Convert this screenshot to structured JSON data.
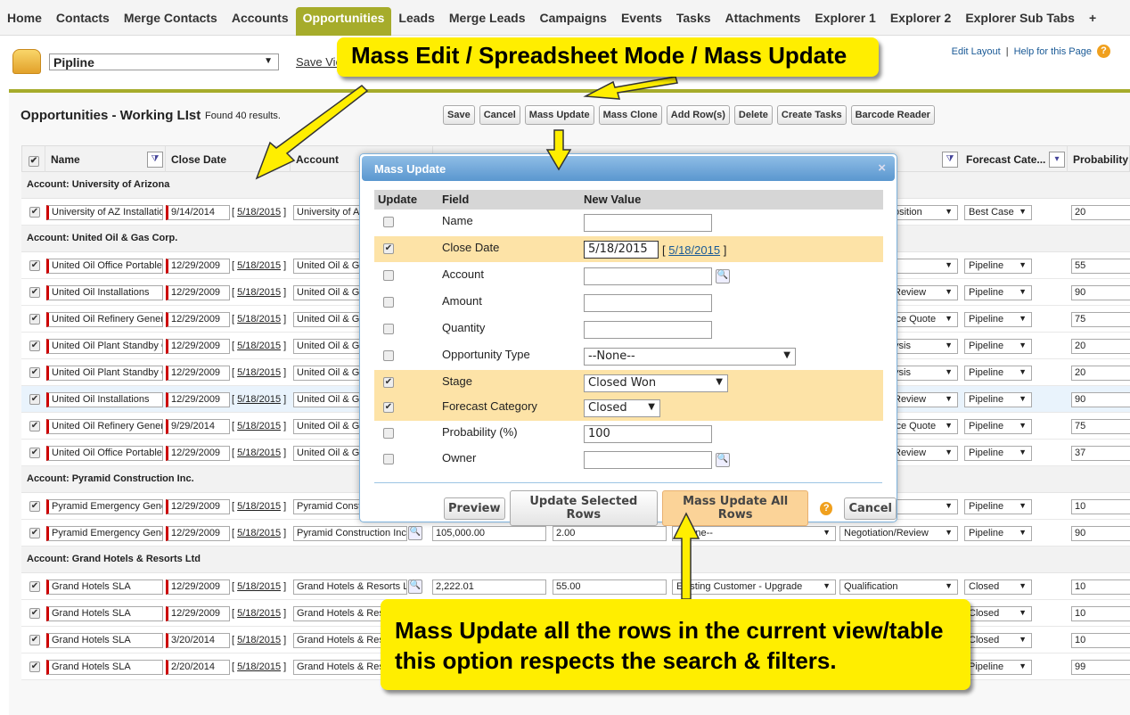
{
  "nav": {
    "tabs": [
      "Home",
      "Contacts",
      "Merge Contacts",
      "Accounts",
      "Opportunities",
      "Leads",
      "Merge Leads",
      "Campaigns",
      "Events",
      "Tasks",
      "Attachments",
      "Explorer 1",
      "Explorer 2",
      "Explorer Sub Tabs",
      "+"
    ],
    "active": "Opportunities"
  },
  "view": {
    "selected": "Pipline",
    "save_view": "Save View"
  },
  "links": {
    "edit_layout": "Edit Layout",
    "sep": "|",
    "help": "Help for this Page",
    "help_icon": "?"
  },
  "list": {
    "title": "Opportunities - Working LIst",
    "found": "Found 40 results."
  },
  "toolbar": [
    "Save",
    "Cancel",
    "Mass Update",
    "Mass Clone",
    "Add Row(s)",
    "Delete",
    "Create Tasks",
    "Barcode Reader"
  ],
  "columns": [
    "Name",
    "Close Date",
    "Account",
    "Forecast Cate...",
    "Probability (%)"
  ],
  "groups": [
    {
      "label": "Account: University of Arizona",
      "rows": [
        {
          "name": "University of AZ Installations",
          "close": "9/14/2014",
          "today": "5/18/2015",
          "account": "University of Arizona",
          "stage": "osition",
          "forecast": "Best Case",
          "prob": "20"
        }
      ]
    },
    {
      "label": "Account: United Oil & Gas Corp.",
      "rows": [
        {
          "name": "United Oil Office Portable",
          "close": "12/29/2009",
          "today": "5/18/2015",
          "account": "United Oil & Gas",
          "stage": "",
          "forecast": "Pipeline",
          "prob": "55"
        },
        {
          "name": "United Oil Installations",
          "close": "12/29/2009",
          "today": "5/18/2015",
          "account": "United Oil & Gas",
          "stage": "Review",
          "forecast": "Pipeline",
          "prob": "90"
        },
        {
          "name": "United Oil Refinery Generators",
          "close": "12/29/2009",
          "today": "5/18/2015",
          "account": "United Oil & Gas",
          "stage": "ice Quote",
          "forecast": "Pipeline",
          "prob": "75"
        },
        {
          "name": "United Oil Plant Standby Gen",
          "close": "12/29/2009",
          "today": "5/18/2015",
          "account": "United Oil & Gas",
          "stage": "ysis",
          "forecast": "Pipeline",
          "prob": "20"
        },
        {
          "name": "United Oil Plant Standby Gen",
          "close": "12/29/2009",
          "today": "5/18/2015",
          "account": "United Oil & Gas",
          "stage": "ysis",
          "forecast": "Pipeline",
          "prob": "20"
        },
        {
          "name": "United Oil Installations",
          "close": "12/29/2009",
          "today": "5/18/2015",
          "account": "United Oil & Gas",
          "stage": "Review",
          "forecast": "Pipeline",
          "prob": "90",
          "hl": true
        },
        {
          "name": "United Oil Refinery Generators",
          "close": "9/29/2014",
          "today": "5/18/2015",
          "account": "United Oil & Gas",
          "stage": "ice Quote",
          "forecast": "Pipeline",
          "prob": "75"
        },
        {
          "name": "United Oil Office Portable",
          "close": "12/29/2009",
          "today": "5/18/2015",
          "account": "United Oil & Gas",
          "stage": "Review",
          "forecast": "Pipeline",
          "prob": "37"
        }
      ]
    },
    {
      "label": "Account: Pyramid Construction Inc.",
      "rows": [
        {
          "name": "Pyramid Emergency Generators",
          "close": "12/29/2009",
          "today": "5/18/2015",
          "account": "Pyramid Construction Inc.",
          "stage": "",
          "forecast": "Pipeline",
          "prob": "10"
        },
        {
          "name": "Pyramid Emergency Generators",
          "close": "12/29/2009",
          "today": "5/18/2015",
          "account": "Pyramid Construction Inc.",
          "amount": "105,000.00",
          "qty": "2.00",
          "type": "--None--",
          "stage": "Negotiation/Review",
          "forecast": "Pipeline",
          "prob": "90"
        }
      ]
    },
    {
      "label": "Account: Grand Hotels & Resorts Ltd",
      "rows": [
        {
          "name": "Grand Hotels SLA",
          "close": "12/29/2009",
          "today": "5/18/2015",
          "account": "Grand Hotels & Resorts Ltd",
          "amount": "2,222.01",
          "qty": "55.00",
          "type": "Existing Customer - Upgrade",
          "stage": "Qualification",
          "forecast": "Closed",
          "prob": "10"
        },
        {
          "name": "Grand Hotels SLA",
          "close": "12/29/2009",
          "today": "5/18/2015",
          "account": "Grand Hotels & Resorts Ltd",
          "forecast": "Closed",
          "prob": "10"
        },
        {
          "name": "Grand Hotels SLA",
          "close": "3/20/2014",
          "today": "5/18/2015",
          "account": "Grand Hotels & Resorts Ltd",
          "forecast": "Closed",
          "prob": "10"
        },
        {
          "name": "Grand Hotels SLA",
          "close": "2/20/2014",
          "today": "5/18/2015",
          "account": "Grand Hotels & Resorts Ltd",
          "forecast": "Pipeline",
          "prob": "99"
        }
      ]
    }
  ],
  "dialog": {
    "title": "Mass Update",
    "close_icon": "×",
    "headers": [
      "Update",
      "Field",
      "New Value"
    ],
    "fields": [
      {
        "label": "Name",
        "checked": false,
        "kind": "text",
        "value": ""
      },
      {
        "label": "Close Date",
        "checked": true,
        "kind": "date",
        "value": "5/18/2015",
        "today": "5/18/2015"
      },
      {
        "label": "Account",
        "checked": false,
        "kind": "lookup",
        "value": ""
      },
      {
        "label": "Amount",
        "checked": false,
        "kind": "text",
        "value": ""
      },
      {
        "label": "Quantity",
        "checked": false,
        "kind": "text",
        "value": ""
      },
      {
        "label": "Opportunity Type",
        "checked": false,
        "kind": "select",
        "value": "--None--"
      },
      {
        "label": "Stage",
        "checked": true,
        "kind": "select",
        "value": "Closed Won"
      },
      {
        "label": "Forecast Category",
        "checked": true,
        "kind": "select",
        "value": "Closed"
      },
      {
        "label": "Probability (%)",
        "checked": false,
        "kind": "text",
        "value": "100"
      },
      {
        "label": "Owner",
        "checked": false,
        "kind": "lookup",
        "value": ""
      }
    ],
    "buttons": {
      "preview": "Preview",
      "selected": "Update Selected Rows",
      "all": "Mass Update All Rows",
      "cancel": "Cancel"
    }
  },
  "callouts": {
    "top": "Mass Edit / Spreadsheet Mode / Mass Update",
    "bottom_line1": "Mass Update all the rows in the current view/table",
    "bottom_line2": "this option respects the search & filters."
  },
  "colors": {
    "accent": "#a6ac2b",
    "callout": "#ffee00",
    "highlight": "#fde3a7",
    "dialog_header": "#5a97cf"
  }
}
